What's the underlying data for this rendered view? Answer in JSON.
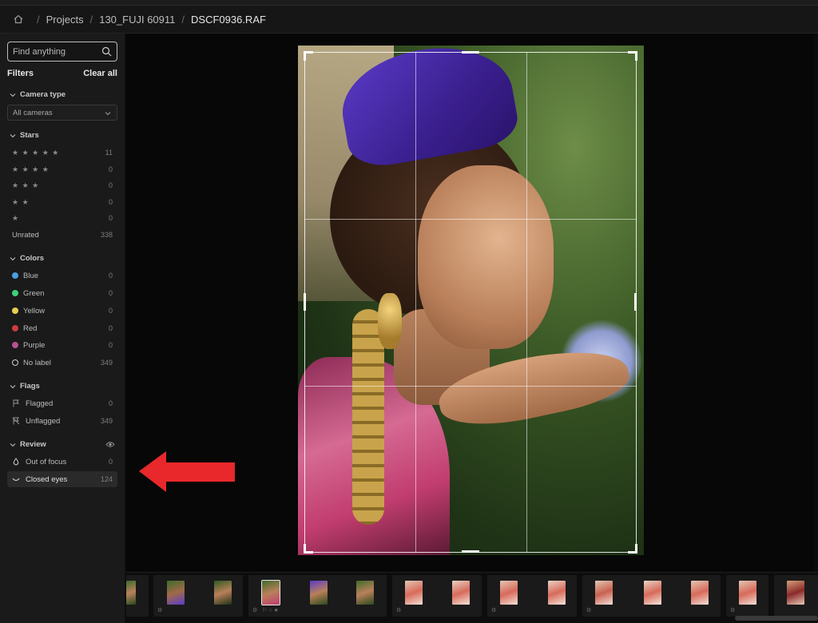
{
  "breadcrumb": {
    "items": [
      "Projects",
      "130_FUJI 60911",
      "DSCF0936.RAF"
    ]
  },
  "search": {
    "placeholder": "Find anything"
  },
  "filters": {
    "title": "Filters",
    "clear_label": "Clear all",
    "camera_type": {
      "label": "Camera type",
      "selected": "All cameras"
    },
    "stars": {
      "label": "Stars",
      "rows": [
        {
          "stars": "★ ★ ★ ★ ★",
          "count": "11"
        },
        {
          "stars": "★ ★ ★ ★",
          "count": "0"
        },
        {
          "stars": "★ ★ ★",
          "count": "0"
        },
        {
          "stars": "★ ★",
          "count": "0"
        },
        {
          "stars": "★",
          "count": "0"
        },
        {
          "stars": "Unrated",
          "count": "338"
        }
      ]
    },
    "colors": {
      "label": "Colors",
      "rows": [
        {
          "label": "Blue",
          "count": "0",
          "color": "#4b9fe0"
        },
        {
          "label": "Green",
          "count": "0",
          "color": "#3ecf7a"
        },
        {
          "label": "Yellow",
          "count": "0",
          "color": "#e7cf52"
        },
        {
          "label": "Red",
          "count": "0",
          "color": "#cf3b3b"
        },
        {
          "label": "Purple",
          "count": "0",
          "color": "#b8508f"
        },
        {
          "label": "No label",
          "count": "349"
        }
      ]
    },
    "flags": {
      "label": "Flags",
      "rows": [
        {
          "label": "Flagged",
          "count": "0",
          "icon": "flag-icon"
        },
        {
          "label": "Unflagged",
          "count": "349",
          "icon": "flag-off-icon"
        }
      ]
    },
    "review": {
      "label": "Review",
      "rows": [
        {
          "label": "Out of focus",
          "count": "0",
          "icon": "drop-icon"
        },
        {
          "label": "Closed eyes",
          "count": "124",
          "icon": "closed-eye-icon"
        }
      ]
    }
  },
  "annotation": {
    "arrow_color": "#e8282b"
  },
  "colors": {
    "accent": "#e8282b",
    "sidebar_bg": "#1a1a1a",
    "viewer_bg": "#070707"
  }
}
